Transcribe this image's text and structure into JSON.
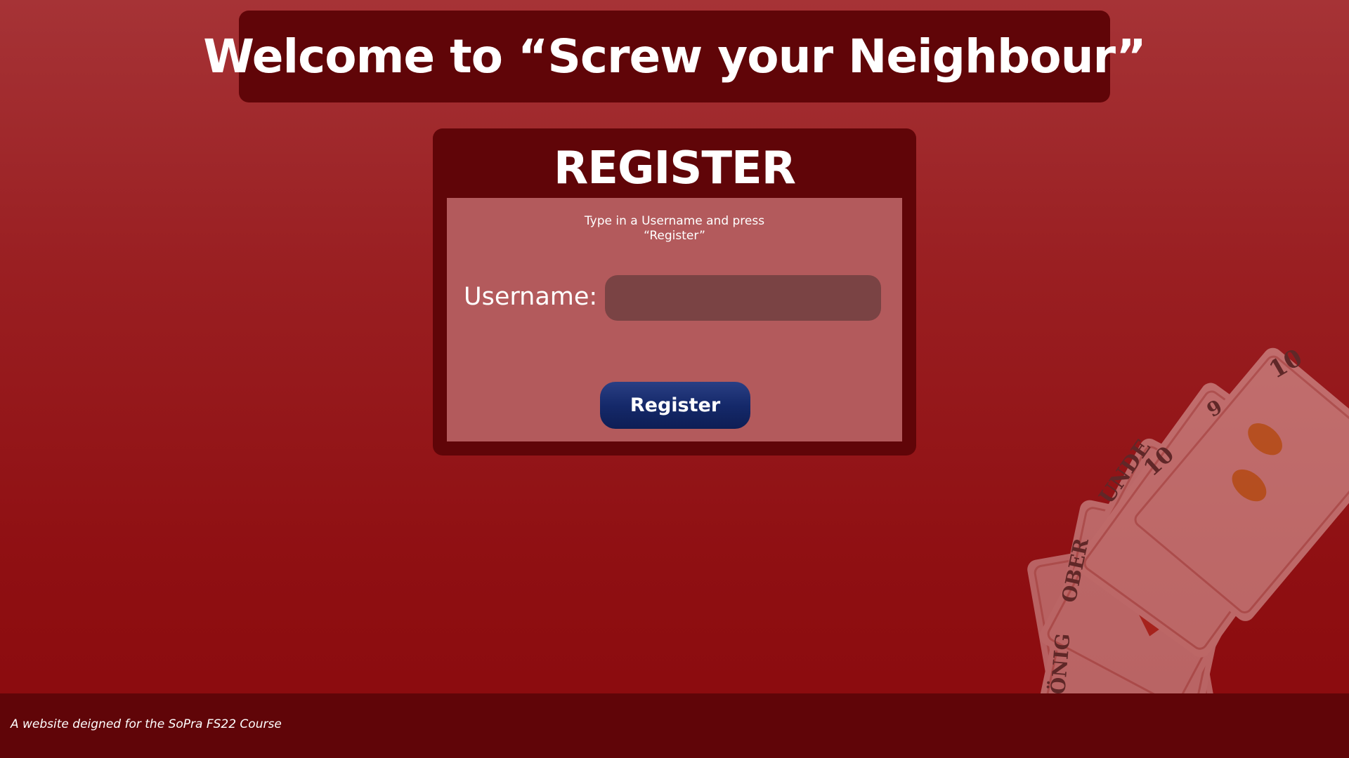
{
  "header": {
    "title": "Welcome to “Screw your Neighbour”"
  },
  "register": {
    "heading": "REGISTER",
    "instructions_line1": "Type in a Username and press",
    "instructions_line2": "“Register”",
    "username_label": "Username:",
    "username_value": "",
    "username_placeholder": "",
    "button_label": "Register"
  },
  "decoration": {
    "card_labels": [
      "10",
      "9",
      "UNDE",
      "10",
      "OBER",
      "ÖNIG"
    ]
  },
  "footer": {
    "text": "A website deigned for the SoPra FS22 Course"
  },
  "colors": {
    "banner": "#600508",
    "form_area": "#b35a5c",
    "input": "#7a4344",
    "button": "#15296a"
  }
}
